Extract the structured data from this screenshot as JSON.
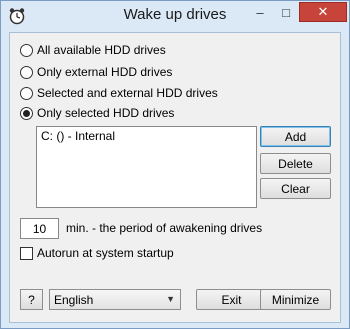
{
  "window": {
    "title": "Wake up drives",
    "minimize_glyph": "–",
    "maximize_glyph": "□",
    "close_glyph": "✕",
    "icon": "app-icon"
  },
  "drive_mode": {
    "options": [
      {
        "label": "All available HDD drives",
        "checked": false
      },
      {
        "label": "Only external HDD drives",
        "checked": false
      },
      {
        "label": "Selected and external HDD drives",
        "checked": false
      },
      {
        "label": "Only selected HDD drives",
        "checked": true
      }
    ]
  },
  "drive_list": {
    "items": [
      "C: () - Internal"
    ]
  },
  "list_buttons": {
    "add": "Add",
    "delete": "Delete",
    "clear": "Clear"
  },
  "period": {
    "value": "10",
    "label": "min. - the period of awakening drives"
  },
  "autorun": {
    "label": "Autorun at system startup",
    "checked": false
  },
  "footer": {
    "help": "?",
    "language": "English",
    "exit": "Exit",
    "minimize": "Minimize"
  },
  "colors": {
    "close_button": "#c7443a",
    "frame": "#dbe8f6",
    "client": "#f0f0f0"
  }
}
